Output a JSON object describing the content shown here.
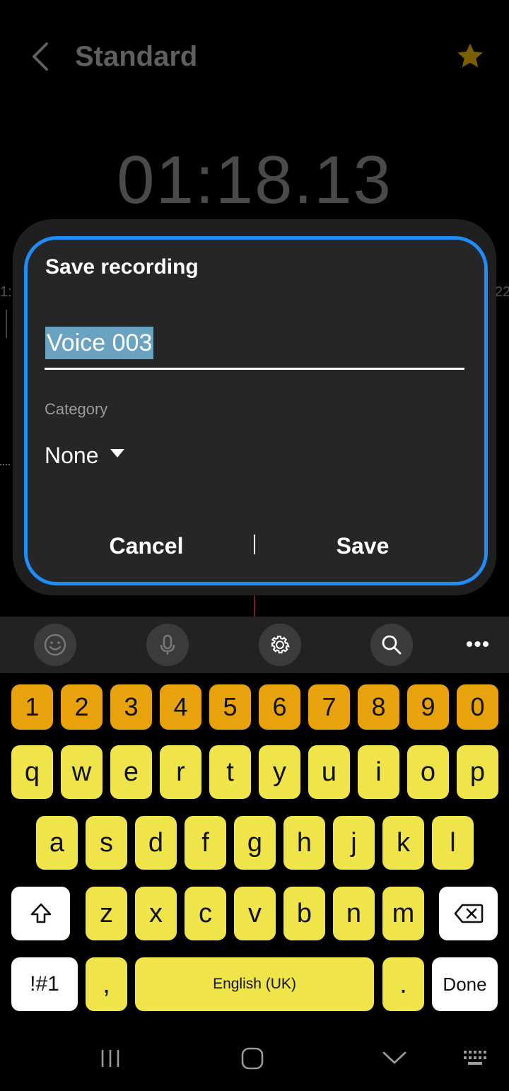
{
  "app": {
    "title": "Standard",
    "timer": "01:18.13",
    "side_left_text": "1:",
    "side_right_text": "22"
  },
  "dialog": {
    "title": "Save recording",
    "name_value": "Voice 003",
    "category_label": "Category",
    "category_value": "None",
    "cancel_label": "Cancel",
    "save_label": "Save"
  },
  "keyboard": {
    "numbers": [
      "1",
      "2",
      "3",
      "4",
      "5",
      "6",
      "7",
      "8",
      "9",
      "0"
    ],
    "row2": [
      "q",
      "w",
      "e",
      "r",
      "t",
      "y",
      "u",
      "i",
      "o",
      "p"
    ],
    "row3": [
      "a",
      "s",
      "d",
      "f",
      "g",
      "h",
      "j",
      "k",
      "l"
    ],
    "row4": [
      "z",
      "x",
      "c",
      "v",
      "b",
      "n",
      "m"
    ],
    "symbols_label": "!#1",
    "comma_label": ",",
    "space_label": "English (UK)",
    "period_label": ".",
    "done_label": "Done"
  },
  "toolbar": {
    "more_label": "•••"
  },
  "colors": {
    "accent_border": "#1e8df7",
    "number_keys": "#e8a20c",
    "letter_keys": "#efe44a",
    "star": "#7a5f00"
  }
}
